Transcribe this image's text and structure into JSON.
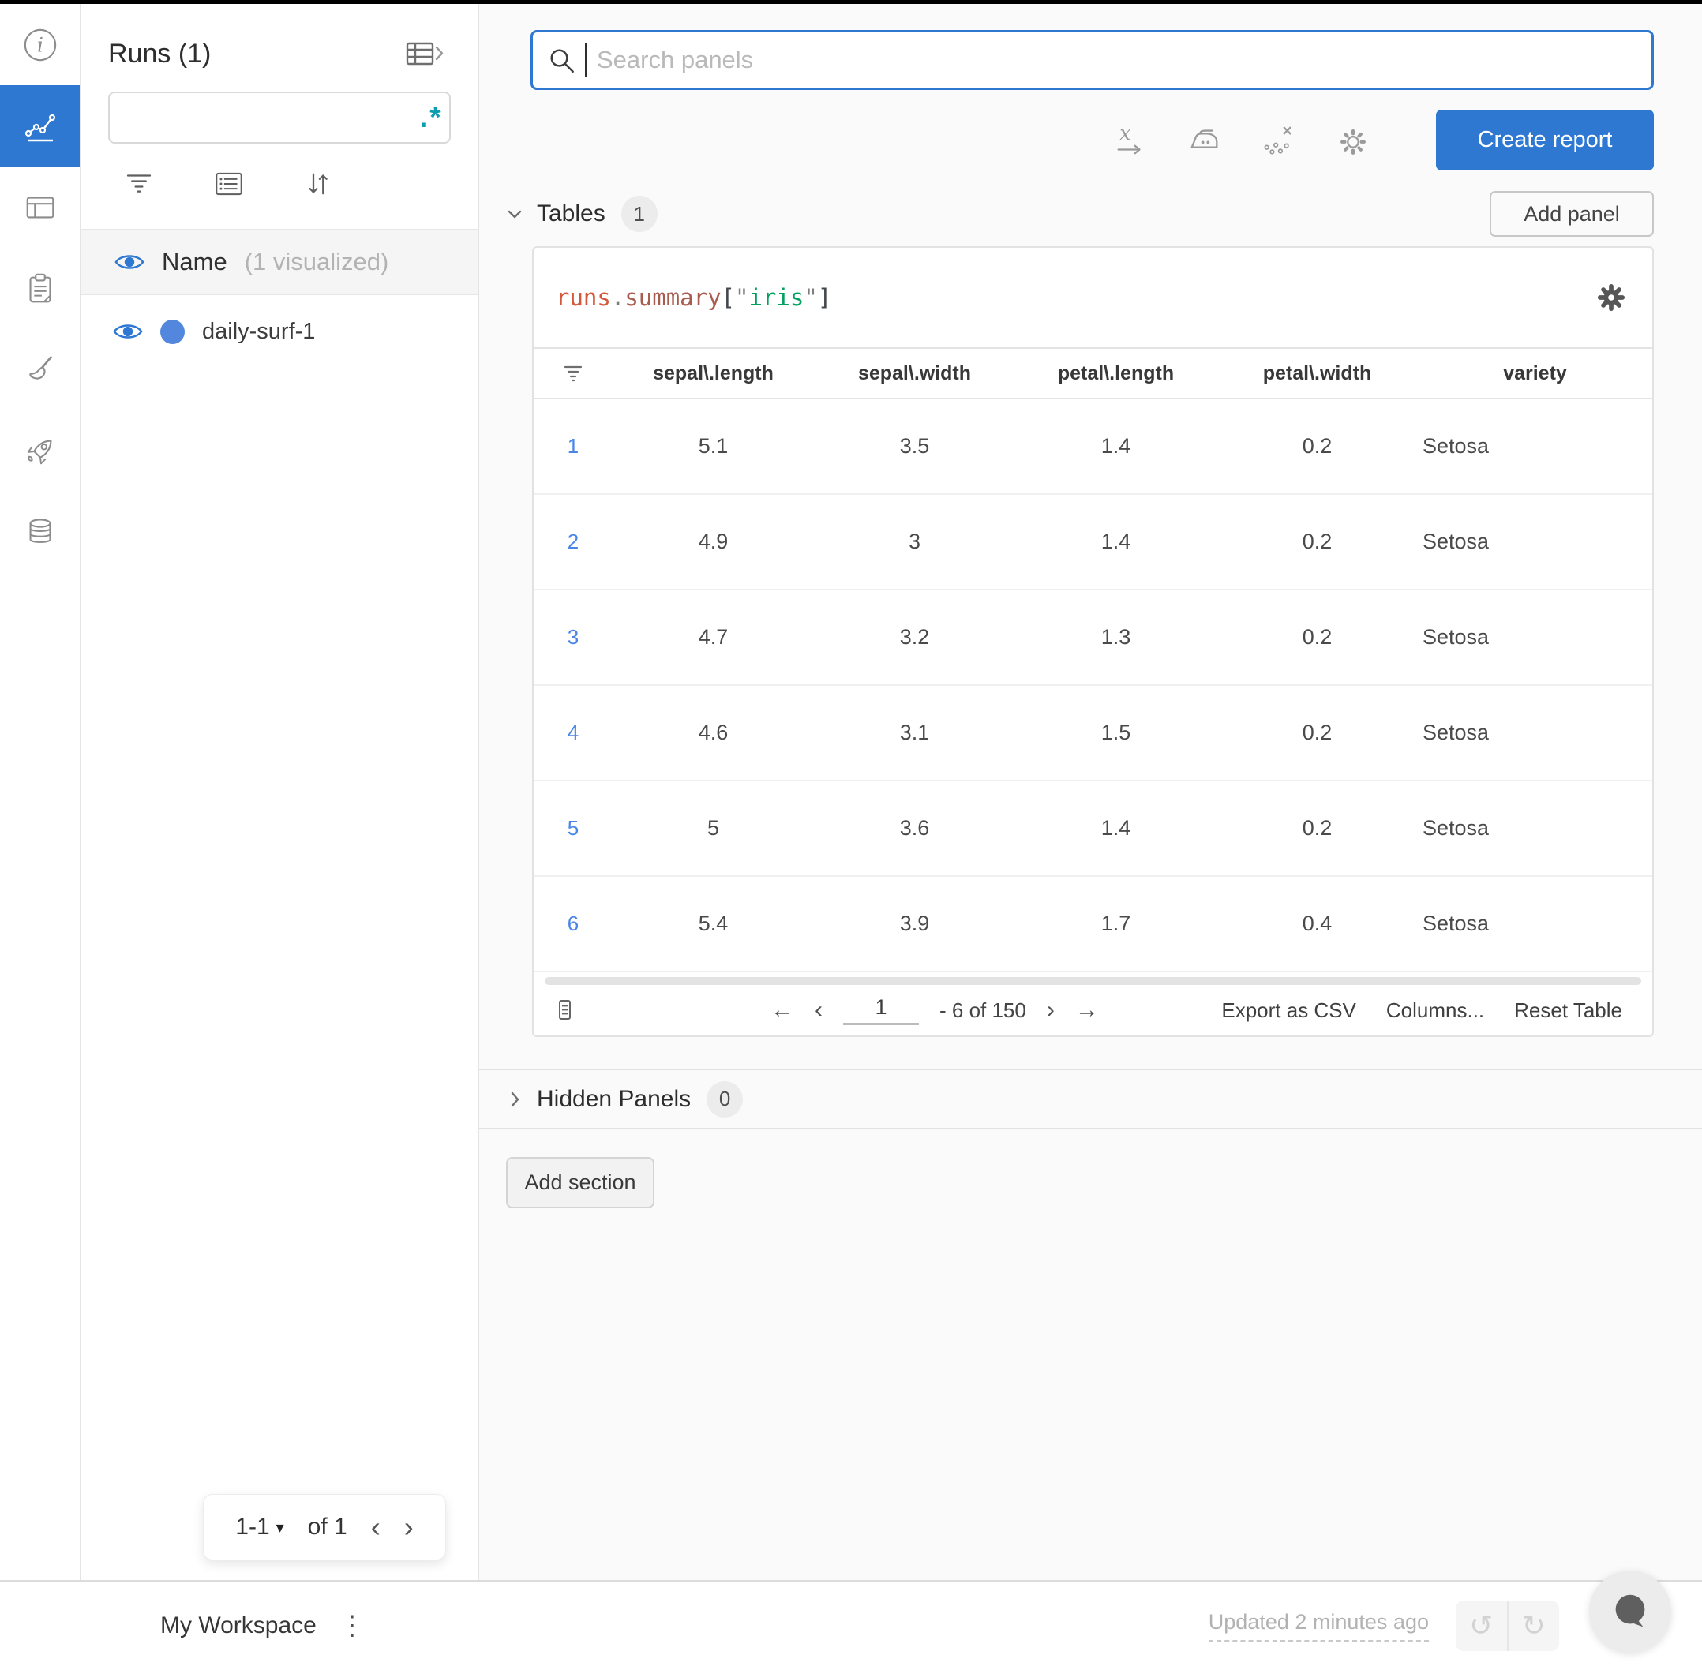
{
  "colors": {
    "accent_blue": "#2e78d2",
    "run_dot_blue": "#5387dd",
    "regex_teal": "#0e9db0",
    "code_obj": "#d4593b",
    "code_prop": "#a85c50",
    "code_string": "#00a05e"
  },
  "icons": {
    "kebab_glyph": "⋮",
    "undo_glyph": "↺",
    "redo_glyph": "↻"
  },
  "runs_sidebar": {
    "title": "Runs (1)",
    "search": {
      "placeholder": "",
      "regex_glyph": ".*"
    },
    "columns_header": {
      "label": "Name",
      "annotation": "(1 visualized)"
    },
    "runs": [
      {
        "name": "daily-surf-1",
        "dot_color": "#5387dd"
      }
    ],
    "pagination": {
      "range_label": "1-1",
      "caret_glyph": "▾",
      "of_label": "of 1",
      "prev_glyph": "‹",
      "next_glyph": "›"
    }
  },
  "toolbar": {
    "search_placeholder": "Search panels",
    "create_report_label": "Create report"
  },
  "panel_sections": {
    "tables": {
      "label": "Tables",
      "count": "1",
      "add_panel_label": "Add panel"
    },
    "hidden": {
      "label": "Hidden Panels",
      "count": "0"
    },
    "add_section_label": "Add section"
  },
  "table_panel": {
    "expression": {
      "obj": "runs",
      "dot": ".",
      "prop": "summary",
      "bracket_open": "[",
      "quote_open": "\"",
      "key": "iris",
      "quote_close": "\"",
      "bracket_close": "]"
    },
    "columns": [
      "sepal\\.length",
      "sepal\\.width",
      "petal\\.length",
      "petal\\.width",
      "variety"
    ],
    "rows": [
      {
        "index": "1",
        "values": [
          "5.1",
          "3.5",
          "1.4",
          "0.2",
          "Setosa"
        ]
      },
      {
        "index": "2",
        "values": [
          "4.9",
          "3",
          "1.4",
          "0.2",
          "Setosa"
        ]
      },
      {
        "index": "3",
        "values": [
          "4.7",
          "3.2",
          "1.3",
          "0.2",
          "Setosa"
        ]
      },
      {
        "index": "4",
        "values": [
          "4.6",
          "3.1",
          "1.5",
          "0.2",
          "Setosa"
        ]
      },
      {
        "index": "5",
        "values": [
          "5",
          "3.6",
          "1.4",
          "0.2",
          "Setosa"
        ]
      },
      {
        "index": "6",
        "values": [
          "5.4",
          "3.9",
          "1.7",
          "0.4",
          "Setosa"
        ]
      }
    ],
    "footer": {
      "page_value": "1",
      "range_label": "- 6 of 150",
      "first_glyph": "←",
      "prev_glyph": "‹",
      "next_glyph": "›",
      "last_glyph": "→",
      "export_label": "Export as CSV",
      "columns_label": "Columns...",
      "reset_label": "Reset Table"
    }
  },
  "bottom_bar": {
    "workspace_label": "My Workspace",
    "updated_label": "Updated 2 minutes ago"
  }
}
